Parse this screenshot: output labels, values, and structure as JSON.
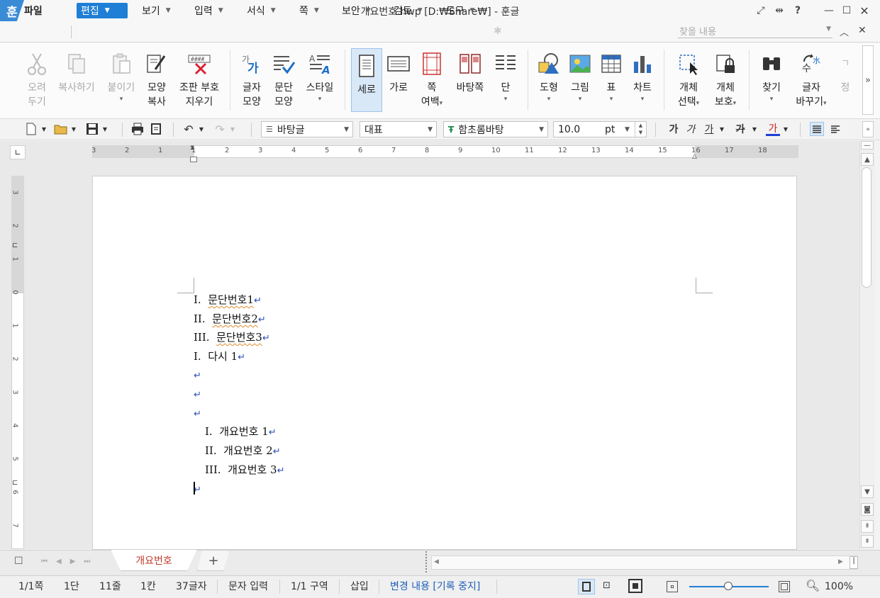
{
  "window": {
    "title": "개요번호.hwp [D:₩Share₩] - 훈글",
    "logo": "훈"
  },
  "menu": {
    "file": "파일",
    "items": [
      {
        "label": "편집",
        "active": true
      },
      {
        "label": "보기"
      },
      {
        "label": "입력"
      },
      {
        "label": "서식"
      },
      {
        "label": "쪽"
      },
      {
        "label": "보안"
      },
      {
        "label": "검토"
      },
      {
        "label": "도구"
      }
    ],
    "search_placeholder": "찾을 내용"
  },
  "ribbon": {
    "cut": [
      "오려",
      "두기"
    ],
    "copy": "복사하기",
    "paste": "붙이기",
    "format_copy": [
      "모양",
      "복사"
    ],
    "clear_marks": [
      "조판 부호",
      "지우기"
    ],
    "char_shape": [
      "글자",
      "모양"
    ],
    "para_shape": [
      "문단",
      "모양"
    ],
    "style": "스타일",
    "portrait": "세로",
    "landscape": "가로",
    "page_margin": [
      "쪽",
      "여백"
    ],
    "master_page": "바탕쪽",
    "columns": "단",
    "shape": "도형",
    "picture": "그림",
    "table": "표",
    "chart": "차트",
    "select_object": [
      "개체",
      "선택"
    ],
    "protect_object": [
      "개체",
      "보호"
    ],
    "find": "찾기",
    "replace": [
      "글자",
      "바꾸기"
    ],
    "cut_off": [
      "ㄱ",
      "정"
    ]
  },
  "toolbar": {
    "style_select": "바탕글",
    "lang_select": "대표",
    "font_select": "함초롬바탕",
    "size": "10.0",
    "size_unit": "pt",
    "bold": "가",
    "italic": "가",
    "underline": "가",
    "strike": "가",
    "color": "가"
  },
  "ruler": {
    "h_labels": [
      "3",
      "2",
      "1",
      "1",
      "2",
      "3",
      "4",
      "5",
      "6",
      "7",
      "8",
      "9",
      "10",
      "11",
      "12",
      "13",
      "14",
      "15",
      "16",
      "17",
      "18"
    ],
    "v_labels": [
      "3",
      "2",
      "1",
      "0",
      "1",
      "2",
      "3",
      "4",
      "5",
      "6",
      "7"
    ]
  },
  "document": {
    "lines": [
      {
        "num": "I.",
        "text": "문단번호1"
      },
      {
        "num": "II.",
        "text": "문단번호2"
      },
      {
        "num": "III.",
        "text": "문단번호3"
      },
      {
        "num": "I.",
        "text": "다시 1"
      },
      {
        "num": "",
        "text": ""
      },
      {
        "num": "",
        "text": ""
      },
      {
        "num": "",
        "text": ""
      },
      {
        "num": "I.",
        "text": "개요번호 1"
      },
      {
        "num": "II.",
        "text": "개요번호 2"
      },
      {
        "num": "III.",
        "text": "개요번호 3"
      },
      {
        "num": "",
        "text": ""
      }
    ],
    "return_mark": "↵"
  },
  "tabs": {
    "active": "개요번호",
    "add": "+"
  },
  "status": {
    "page": "1/1쪽",
    "column": "1단",
    "line": "11줄",
    "char_col": "1칸",
    "char_count": "37글자",
    "input_mode": "문자 입력",
    "section": "1/1 구역",
    "insert_mode": "삽입",
    "track_changes": "변경 내용 [기록 중지]",
    "zoom": "100%"
  }
}
